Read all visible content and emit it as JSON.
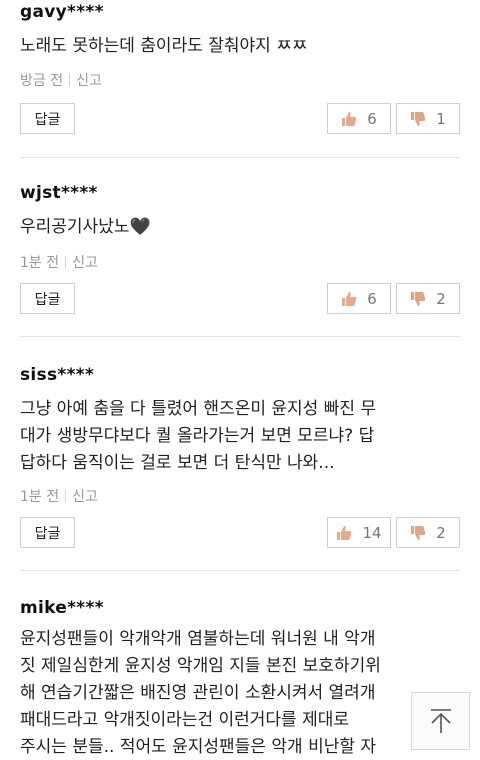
{
  "comments": [
    {
      "author": "gavy****",
      "text_lines": [
        "노래도 못하는데 춤이라도 잘춰야지 ㅉㅉ"
      ],
      "time": "방금 전",
      "report": "신고",
      "reply": "답글",
      "likes": "6",
      "dislikes": "1"
    },
    {
      "author": "wjst****",
      "text_lines": [
        "우리공기사났노🖤"
      ],
      "time": "1분 전",
      "report": "신고",
      "reply": "답글",
      "likes": "6",
      "dislikes": "2"
    },
    {
      "author": "siss****",
      "text_lines": [
        "그냥 아예 춤을 다 틀렸어 핸즈온미 윤지성 빠진 무",
        "대가 생방무댜보다 퀄 올라가는거 보면 모르냐? 답",
        "답하다 움직이는 걸로 보면 더 탄식만 나와..."
      ],
      "time": "1분 전",
      "report": "신고",
      "reply": "답글",
      "likes": "14",
      "dislikes": "2"
    },
    {
      "author": "mike****",
      "text_lines": [
        "윤지성팬들이 악개악개 염불하는데 워너원 내 악개",
        "짓 제일심한게 윤지성 악개임 지들 본진 보호하기위",
        "해 연습기간짧은 배진영 관린이 소환시켜서 열려개",
        "패대드라고 악개짓이라는건 이런거다를 제대로 ",
        "주시는 분들.. 적어도 윤지성팬들은 악개 비난할 자"
      ]
    }
  ],
  "icons": {
    "like": "thumbs-up-icon",
    "dislike": "thumbs-down-icon",
    "scroll_top": "arrow-up-icon"
  },
  "colors": {
    "thumb_up": "#e8a98a",
    "thumb_down": "#e0a486"
  }
}
